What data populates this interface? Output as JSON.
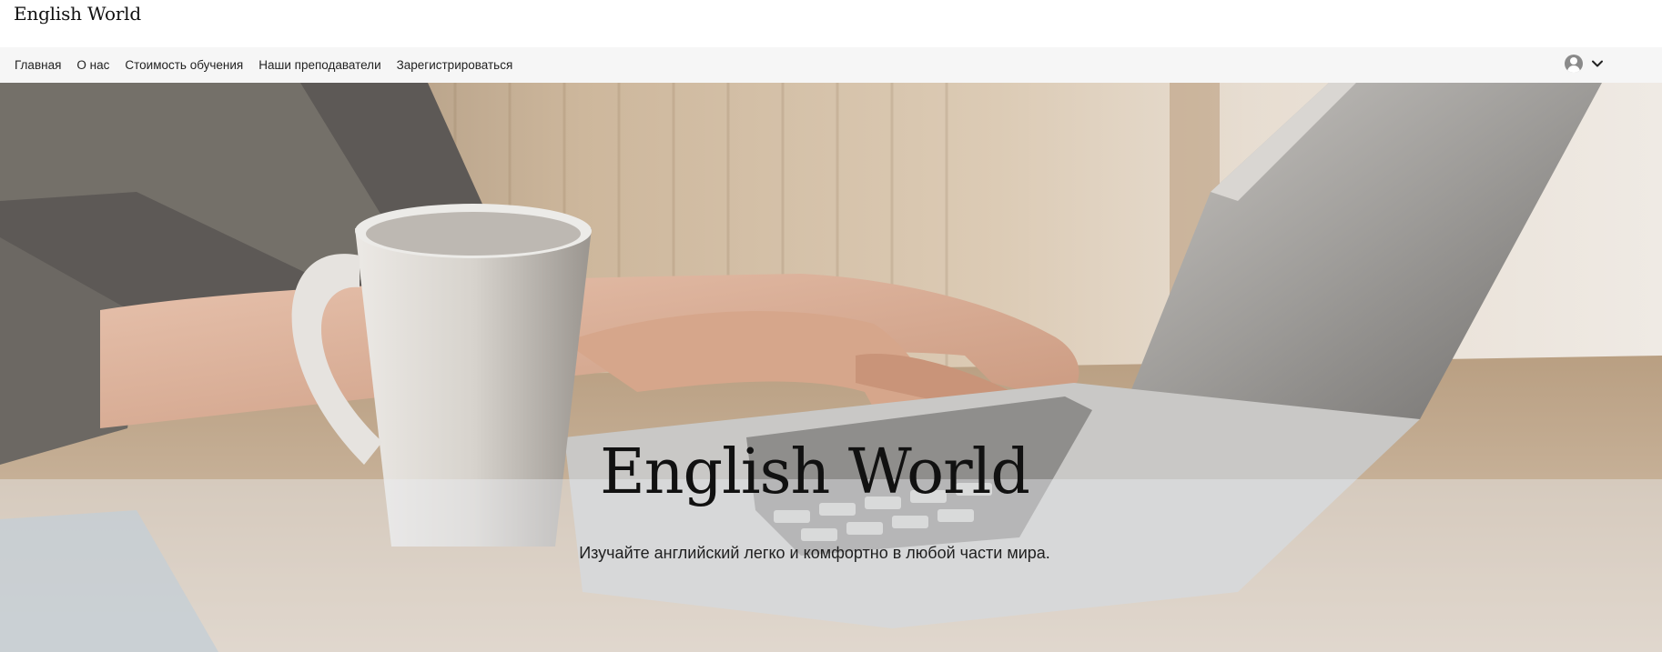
{
  "header": {
    "logo_text": "English World"
  },
  "nav": {
    "items": [
      {
        "label": "Главная"
      },
      {
        "label": "О нас"
      },
      {
        "label": "Стоимость обучения"
      },
      {
        "label": "Наши преподаватели"
      },
      {
        "label": "Зарегистрироваться"
      }
    ]
  },
  "account": {
    "icons": [
      "avatar-icon",
      "chevron-down-icon"
    ]
  },
  "hero": {
    "title": "English World",
    "subtitle": "Изучайте английский легко и комфортно в любой части мира."
  },
  "colors": {
    "nav_background": "#f6f6f6",
    "text": "#1a1a1a",
    "hero_band": "rgba(236,238,242,0.42)"
  }
}
